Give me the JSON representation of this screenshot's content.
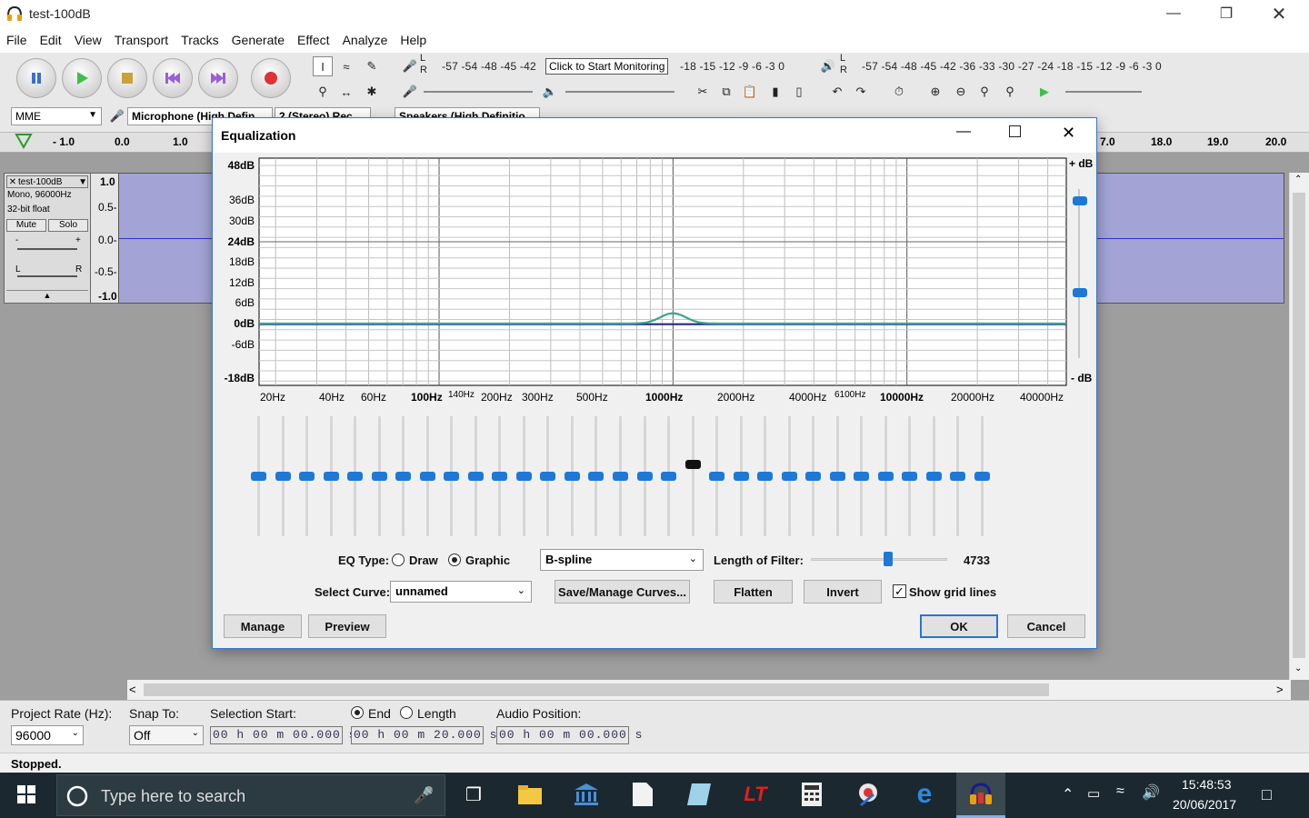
{
  "window": {
    "title": "test-100dB"
  },
  "menu": [
    "File",
    "Edit",
    "View",
    "Transport",
    "Tracks",
    "Generate",
    "Effect",
    "Analyze",
    "Help"
  ],
  "toolbar": {
    "rec_meter_scale": "-57 -54    -48 -45 -42",
    "rec_meter_scale2": "-18 -15 -12  -9  -6  -3  0",
    "monitor_tooltip": "Click to Start Monitoring",
    "play_meter_scale": "-57 -54     -48 -45 -42     -36 -33 -30 -27 -24     -18 -15 -12  -9  -6  -3  0",
    "host": "MME",
    "mic": "Microphone (High Defin",
    "channels": "2 (Stereo) Rec",
    "speakers": "Speakers (High Definitio"
  },
  "ruler": {
    "ticks_left": [
      "- 1.0",
      "0.0",
      "1.0"
    ],
    "ticks_right": [
      "7.0",
      "18.0",
      "19.0",
      "20.0"
    ]
  },
  "track": {
    "name": "test-100dB",
    "info1": "Mono, 96000Hz",
    "info2": "32-bit float",
    "mute": "Mute",
    "solo": "Solo",
    "scale": [
      "1.0",
      "0.5-",
      "0.0-",
      "-0.5-",
      "-1.0"
    ],
    "gain_minus": "-",
    "gain_plus": "+",
    "pan_l": "L",
    "pan_r": "R"
  },
  "selection": {
    "project_rate_label": "Project Rate (Hz):",
    "project_rate": "96000",
    "snap_label": "Snap To:",
    "snap": "Off",
    "sel_start_label": "Selection Start:",
    "end_label": "End",
    "length_label": "Length",
    "audio_pos_label": "Audio Position:",
    "start": "00 h 00 m 00.000 s",
    "end": "00 h 00 m 20.000 s",
    "audio_pos": "00 h 00 m 00.000 s"
  },
  "status": "Stopped.",
  "taskbar": {
    "search": "Type here to search",
    "time": "15:48:53",
    "date": "20/06/2017"
  },
  "dialog": {
    "title": "Equalization",
    "db_labels": [
      "48dB",
      "36dB",
      "30dB",
      "24dB",
      "18dB",
      "12dB",
      "6dB",
      "0dB",
      "-6dB",
      "-18dB"
    ],
    "freq_labels": [
      "20Hz",
      "40Hz",
      "60Hz",
      "100Hz",
      "140Hz",
      "200Hz",
      "300Hz",
      "500Hz",
      "1000Hz",
      "2000Hz",
      "4000Hz",
      "6100Hz",
      "10000Hz",
      "20000Hz",
      "40000Hz"
    ],
    "plus_db": "+ dB",
    "minus_db": "- dB",
    "eq_type_label": "EQ Type:",
    "draw": "Draw",
    "graphic": "Graphic",
    "interp": "B-spline",
    "filter_len_label": "Length of Filter:",
    "filter_len": "4733",
    "select_curve_label": "Select Curve:",
    "curve": "unnamed",
    "save_manage": "Save/Manage Curves...",
    "flatten": "Flatten",
    "invert": "Invert",
    "grid_lines": "Show grid lines",
    "manage": "Manage",
    "preview": "Preview",
    "ok": "OK",
    "cancel": "Cancel",
    "colors": {
      "curve": "#3aa58f",
      "zero": "#1a1a8c",
      "slider": "#1e78d6"
    }
  },
  "eq_sliders_db": [
    0,
    0,
    0,
    0,
    0,
    0,
    0,
    0,
    0,
    0,
    0,
    0,
    0,
    0,
    0,
    0,
    0,
    0,
    3,
    0,
    0,
    0,
    0,
    0,
    0,
    0,
    0,
    0,
    0,
    0,
    0
  ]
}
